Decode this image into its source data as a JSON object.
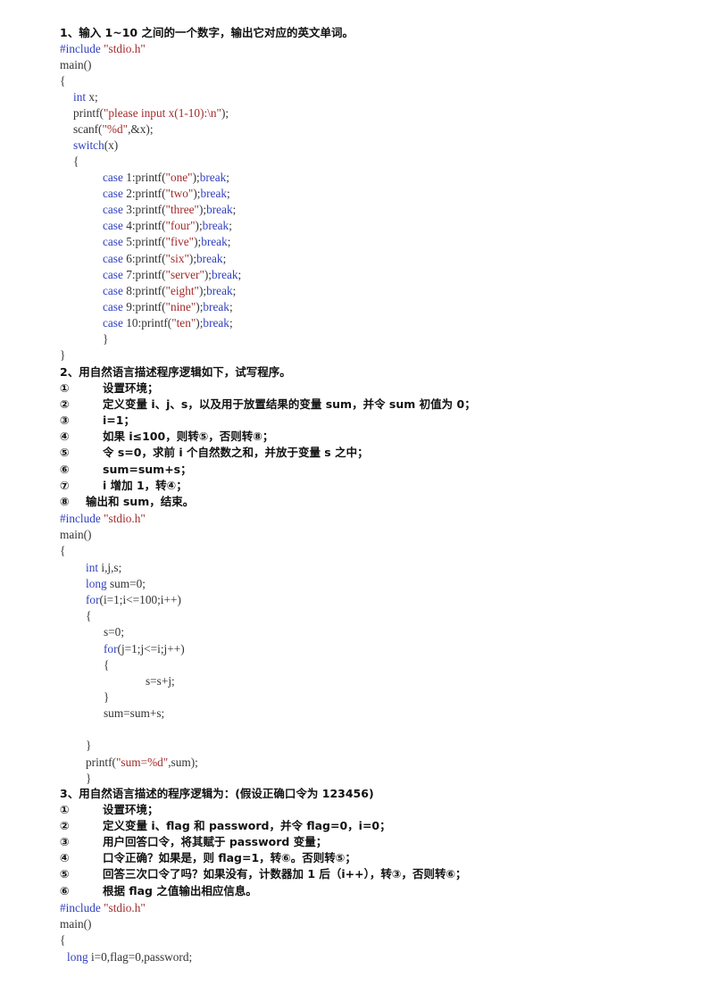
{
  "colors": {
    "keyword": "#2f3fbf",
    "string": "#a32a2a",
    "text": "#333333",
    "heading": "#111111"
  },
  "section1": {
    "title": "1、输入 1~10 之间的一个数字，输出它对应的英文单词。",
    "code": {
      "include_kw": "#include",
      "include_str": " \"stdio.h\"",
      "main": "main()",
      "open_brace": "{",
      "decl_kw": "int",
      "decl_rest": " x;",
      "printf_pre": "printf(",
      "printf_str": "\"please input x(1-10):\\n\"",
      "printf_post": ");",
      "scanf_pre": "scanf(",
      "scanf_str": "\"%d\"",
      "scanf_post": ",&x);",
      "switch_kw": "switch",
      "switch_rest": "(x)",
      "switch_open": "{",
      "cases": [
        {
          "kw": "case",
          "num": " 1:printf(",
          "str": "\"one\"",
          "end": ");",
          "brk": "break",
          "semi": ";"
        },
        {
          "kw": "case",
          "num": " 2:printf(",
          "str": "\"two\"",
          "end": ");",
          "brk": "break",
          "semi": ";"
        },
        {
          "kw": "case",
          "num": " 3:printf(",
          "str": "\"three\"",
          "end": ");",
          "brk": "break",
          "semi": ";"
        },
        {
          "kw": "case",
          "num": " 4:printf(",
          "str": "\"four\"",
          "end": ");",
          "brk": "break",
          "semi": ";"
        },
        {
          "kw": "case",
          "num": " 5:printf(",
          "str": "\"five\"",
          "end": ");",
          "brk": "break",
          "semi": ";"
        },
        {
          "kw": "case",
          "num": " 6:printf(",
          "str": "\"six\"",
          "end": ");",
          "brk": "break",
          "semi": ";"
        },
        {
          "kw": "case",
          "num": " 7:printf(",
          "str": "\"server\"",
          "end": ");",
          "brk": "break",
          "semi": ";"
        },
        {
          "kw": "case",
          "num": " 8:printf(",
          "str": "\"eight\"",
          "end": ");",
          "brk": "break",
          "semi": ";"
        },
        {
          "kw": "case",
          "num": " 9:printf(",
          "str": "\"nine\"",
          "end": ");",
          "brk": "break",
          "semi": ";"
        },
        {
          "kw": "case",
          "num": " 10:printf(",
          "str": "\"ten\"",
          "end": ");",
          "brk": "break",
          "semi": ";"
        }
      ],
      "switch_close": "}",
      "close_brace": "}"
    }
  },
  "section2": {
    "title": "2、用自然语言描述程序逻辑如下，试写程序。",
    "steps": [
      {
        "num": "①",
        "text": "设置环境；"
      },
      {
        "num": "②",
        "text": "定义变量 i、j、s，以及用于放置结果的变量 sum，并令 sum 初值为 0；"
      },
      {
        "num": "③",
        "text": "i=1；"
      },
      {
        "num": "④",
        "text": "如果 i≤100，则转⑤，否则转⑧；"
      },
      {
        "num": "⑤",
        "text": "令 s=0，求前 i 个自然数之和，并放于变量 s 之中；"
      },
      {
        "num": "⑥",
        "text": "sum=sum+s；"
      },
      {
        "num": "⑦",
        "text": "i 增加 1，转④；"
      },
      {
        "num": "⑧",
        "text": "输出和 sum，结束。"
      }
    ],
    "code": {
      "include_kw": "#include",
      "include_str": " \"stdio.h\"",
      "main": "main()",
      "open_brace": "{",
      "decl1_kw": "int",
      "decl1_rest": " i,j,s;",
      "decl2_kw": "long",
      "decl2_rest": " sum=0;",
      "for1_kw": "for",
      "for1_rest": "(i=1;i<=100;i++)",
      "for1_open": "{",
      "s_init": "s=0;",
      "for2_kw": "for",
      "for2_rest": "(j=1;j<=i;j++)",
      "for2_open": "{",
      "s_add": "s=s+j;",
      "for2_close": "}",
      "sum_add": "sum=sum+s;",
      "for1_close": "}",
      "printf_pre": "printf(",
      "printf_str": "\"sum=%d\"",
      "printf_post": ",sum);",
      "close_brace": "}"
    }
  },
  "section3": {
    "title": "3、用自然语言描述的程序逻辑为：(假设正确口令为 123456)",
    "steps": [
      {
        "num": "①",
        "text": "设置环境；"
      },
      {
        "num": "②",
        "text": "定义变量 i、flag 和 password，并令 flag=0，i=0；"
      },
      {
        "num": "③",
        "text": "用户回答口令，将其赋于 password 变量；"
      },
      {
        "num": "④",
        "text": "口令正确？如果是，则 flag=1，转⑥。否则转⑤；"
      },
      {
        "num": "⑤",
        "text": "回答三次口令了吗？如果没有，计数器加 1 后（i++），转③，否则转⑥；"
      },
      {
        "num": "⑥",
        "text": "根据 flag 之值输出相应信息。"
      }
    ],
    "code": {
      "include_kw": "#include",
      "include_str": " \"stdio.h\"",
      "main": "main()",
      "open_brace": "{",
      "decl_kw": "long",
      "decl_rest": " i=0,flag=0,password;"
    }
  }
}
